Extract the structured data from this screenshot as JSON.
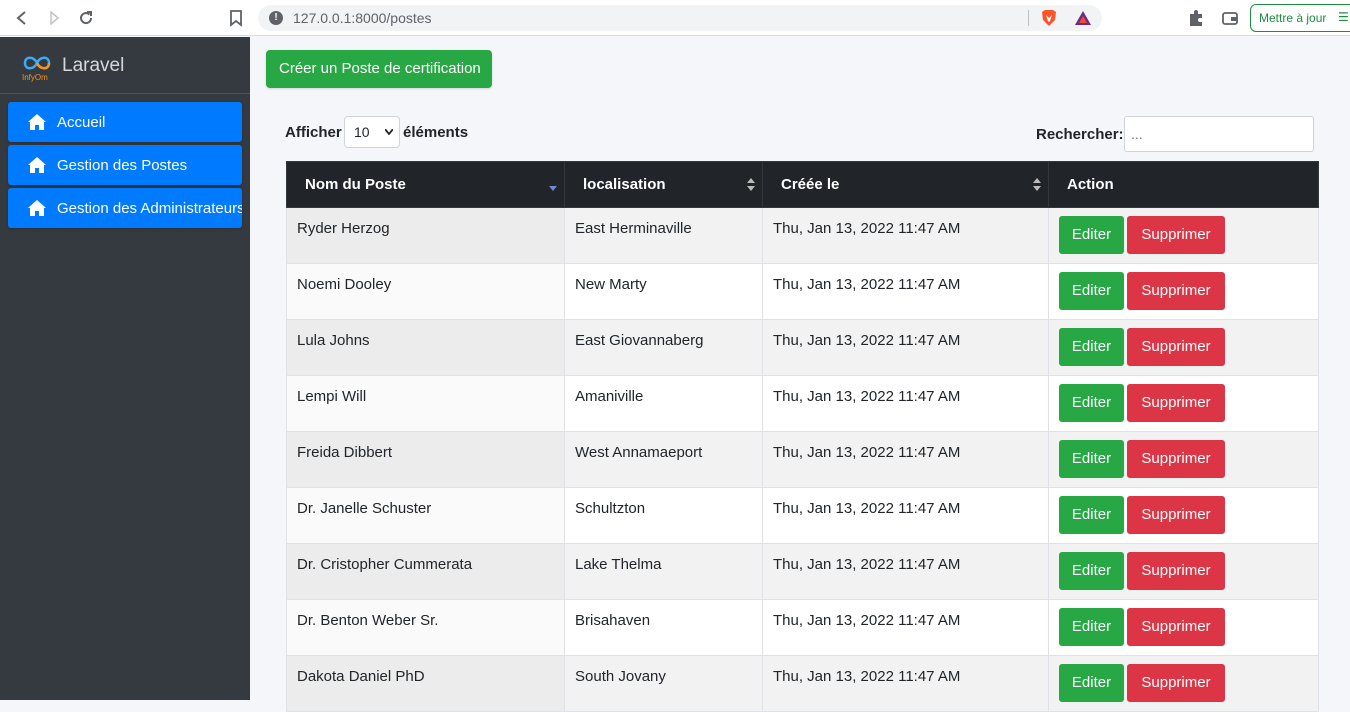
{
  "browser": {
    "url": "127.0.0.1:8000/postes",
    "update_label": "Mettre à jour"
  },
  "sidebar": {
    "brand": "Laravel",
    "items": [
      {
        "label": "Accueil",
        "icon": "home-icon"
      },
      {
        "label": "Gestion des Postes",
        "icon": "home-icon"
      },
      {
        "label": "Gestion des Administrateurs",
        "icon": "home-icon"
      }
    ]
  },
  "main": {
    "create_button": "Créer un Poste de certification",
    "length_label_before": "Afficher",
    "length_value": "10",
    "length_label_after": "éléments",
    "search_label": "Rechercher:",
    "search_placeholder": "...",
    "table": {
      "columns": [
        "Nom du Poste",
        "localisation",
        "Créée le",
        "Action"
      ],
      "edit_label": "Editer",
      "delete_label": "Supprimer",
      "rows": [
        {
          "name": "Ryder Herzog",
          "location": "East Herminaville",
          "created": "Thu, Jan 13, 2022 11:47 AM"
        },
        {
          "name": "Noemi Dooley",
          "location": "New Marty",
          "created": "Thu, Jan 13, 2022 11:47 AM"
        },
        {
          "name": "Lula Johns",
          "location": "East Giovannaberg",
          "created": "Thu, Jan 13, 2022 11:47 AM"
        },
        {
          "name": "Lempi Will",
          "location": "Amaniville",
          "created": "Thu, Jan 13, 2022 11:47 AM"
        },
        {
          "name": "Freida Dibbert",
          "location": "West Annamaeport",
          "created": "Thu, Jan 13, 2022 11:47 AM"
        },
        {
          "name": "Dr. Janelle Schuster",
          "location": "Schultzton",
          "created": "Thu, Jan 13, 2022 11:47 AM"
        },
        {
          "name": "Dr. Cristopher Cummerata",
          "location": "Lake Thelma",
          "created": "Thu, Jan 13, 2022 11:47 AM"
        },
        {
          "name": "Dr. Benton Weber Sr.",
          "location": "Brisahaven",
          "created": "Thu, Jan 13, 2022 11:47 AM"
        },
        {
          "name": "Dakota Daniel PhD",
          "location": "South Jovany",
          "created": "Thu, Jan 13, 2022 11:47 AM"
        }
      ]
    }
  },
  "colors": {
    "sidebar_bg": "#343a40",
    "nav_active": "#007bff",
    "success": "#28a745",
    "danger": "#dc3545",
    "table_header": "#212529"
  }
}
